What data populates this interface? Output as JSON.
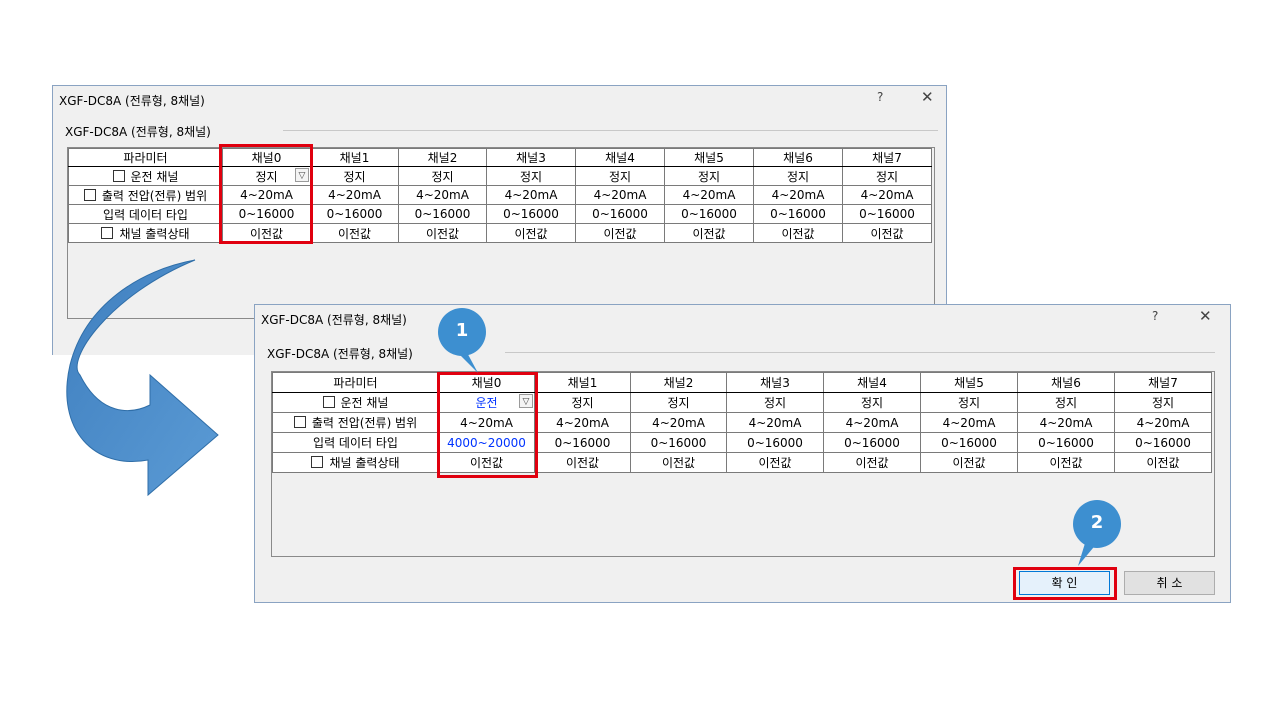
{
  "params": {
    "header_label": "파라미터",
    "channels": [
      "채널0",
      "채널1",
      "채널2",
      "채널3",
      "채널4",
      "채널5",
      "채널6",
      "채널7"
    ],
    "row_labels": [
      "운전 채널",
      "출력 전압(전류) 범위",
      "입력 데이터 타입",
      "채널 출력상태"
    ],
    "row_checkbox": [
      true,
      true,
      false,
      true
    ]
  },
  "dialog_before": {
    "title": "XGF-DC8A (전류형, 8채널)",
    "group_label": "XGF-DC8A (전류형, 8채널)",
    "help": "?",
    "close": "✕",
    "rows": [
      [
        "정지",
        "정지",
        "정지",
        "정지",
        "정지",
        "정지",
        "정지",
        "정지"
      ],
      [
        "4~20mA",
        "4~20mA",
        "4~20mA",
        "4~20mA",
        "4~20mA",
        "4~20mA",
        "4~20mA",
        "4~20mA"
      ],
      [
        "0~16000",
        "0~16000",
        "0~16000",
        "0~16000",
        "0~16000",
        "0~16000",
        "0~16000",
        "0~16000"
      ],
      [
        "이전값",
        "이전값",
        "이전값",
        "이전값",
        "이전값",
        "이전값",
        "이전값",
        "이전값"
      ]
    ]
  },
  "dialog_after": {
    "title": "XGF-DC8A (전류형, 8채널)",
    "group_label": "XGF-DC8A (전류형, 8채널)",
    "help": "?",
    "close": "✕",
    "rows": [
      [
        "운전",
        "정지",
        "정지",
        "정지",
        "정지",
        "정지",
        "정지",
        "정지"
      ],
      [
        "4~20mA",
        "4~20mA",
        "4~20mA",
        "4~20mA",
        "4~20mA",
        "4~20mA",
        "4~20mA",
        "4~20mA"
      ],
      [
        "4000~20000",
        "0~16000",
        "0~16000",
        "0~16000",
        "0~16000",
        "0~16000",
        "0~16000",
        "0~16000"
      ],
      [
        "이전값",
        "이전값",
        "이전값",
        "이전값",
        "이전값",
        "이전값",
        "이전값",
        "이전값"
      ]
    ],
    "ok_label": "확 인",
    "cancel_label": "취 소"
  },
  "callouts": {
    "step1": "1",
    "step2": "2"
  },
  "colors": {
    "highlight": "#e0000f",
    "changed_value": "#0033ff",
    "callout": "#3d8fd0",
    "arrow": "#4a8ccc"
  }
}
